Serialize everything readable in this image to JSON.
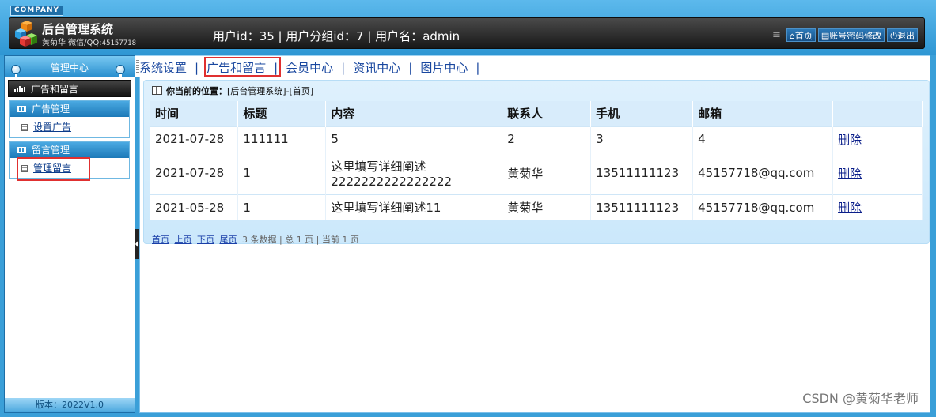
{
  "brand": {
    "company": "COMPANY",
    "title": "后台管理系统",
    "sub_name": "黄菊华 微信/QQ:",
    "sub_qq": "45157718"
  },
  "header": {
    "userinfo": "用户id：35 | 用户分组id：7 | 用户名：admin",
    "home": "首页",
    "password": "账号密码修改",
    "logout": "退出"
  },
  "sidebar": {
    "title": "管理中心",
    "category": "广告和留言",
    "groups": [
      {
        "title": "广告管理",
        "items": [
          "设置广告"
        ]
      },
      {
        "title": "留言管理",
        "items": [
          "管理留言"
        ]
      }
    ],
    "version": "版本：2022V1.0"
  },
  "nav": {
    "items": [
      "系统设置",
      "广告和留言",
      "会员中心",
      "资讯中心",
      "图片中心"
    ]
  },
  "location": {
    "label": "你当前的位置：",
    "path": "[后台管理系统]-[首页]"
  },
  "table": {
    "headers": [
      "时间",
      "标题",
      "内容",
      "联系人",
      "手机",
      "邮箱",
      ""
    ],
    "rows": [
      [
        "2021-07-28",
        "111111",
        "5",
        "2",
        "3",
        "4",
        "删除"
      ],
      [
        "2021-07-28",
        "1",
        "这里填写详细阐述",
        "黄菊华",
        "13511111123",
        "45157718@qq.com",
        "删除"
      ],
      [
        "2021-05-28",
        "1",
        "这里填写详细阐述11",
        "黄菊华",
        "13511111123",
        "45157718@qq.com",
        "删除"
      ]
    ],
    "row2_content_line2": "2222222222222222"
  },
  "pager": {
    "first": "首页",
    "prev": "上页",
    "next": "下页",
    "last": "尾页",
    "summary": "3 条数据 | 总 1 页 | 当前 1 页"
  },
  "watermark": "CSDN @黄菊华老师"
}
